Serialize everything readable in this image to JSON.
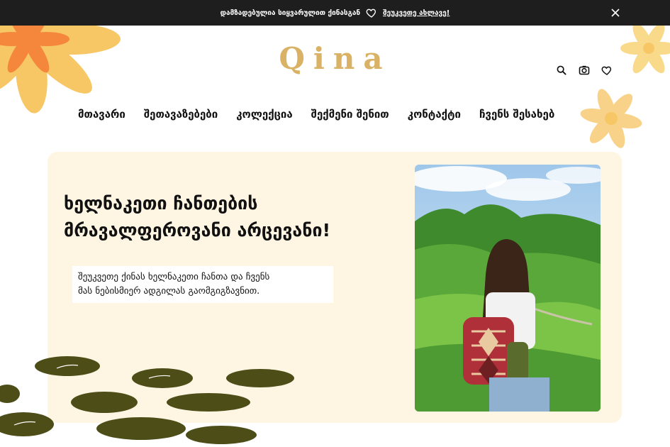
{
  "announcement": {
    "message": "დამზადებულია სიყვარულით ქინასგან",
    "link_label": "შეუკვეთე ახლავე!",
    "icons": {
      "heart": "heart-icon",
      "close": "close-icon"
    }
  },
  "brand": {
    "logo_text": "Qina",
    "accent_color": "#d9b266"
  },
  "header_icons": [
    "search-icon",
    "camera-icon",
    "heart-icon"
  ],
  "nav": {
    "items": [
      {
        "label": "მთავარი"
      },
      {
        "label": "შეთავაზებები"
      },
      {
        "label": "კოლექცია"
      },
      {
        "label": "შექმენი შენით"
      },
      {
        "label": "კონტაქტი"
      },
      {
        "label": "ჩვენს შესახებ"
      }
    ]
  },
  "hero": {
    "title_lines": [
      "ხელნაკეთი ჩანთების",
      "მრავალფეროვანი არცევანი!"
    ],
    "description_lines": [
      "შეუკვეთე ქინას ხელნაკეთი ჩანთა და ჩვენს",
      "მას ნებისმიერ ადგილას გაომგიგზავნით."
    ],
    "background_color": "#fff5e3"
  },
  "colors": {
    "topbar": "#1e1e1e",
    "flower_orange": "#f5a623",
    "flower_yellow": "#f7c766",
    "stones": "#4d4d18"
  }
}
